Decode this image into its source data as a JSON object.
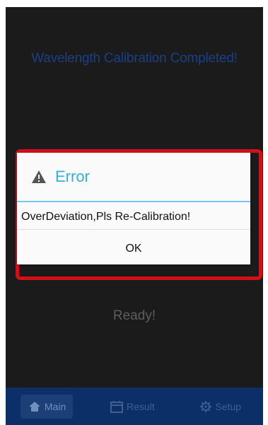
{
  "screen": {
    "status_title": "Wavelength Calibration Completed!",
    "ready_text": "Ready!"
  },
  "dialog": {
    "icon": "warning-icon",
    "title": "Error",
    "message": "OverDeviation,Pls Re-Calibration!",
    "ok_label": "OK"
  },
  "navbar": {
    "items": [
      {
        "label": "Main",
        "icon": "home-icon",
        "active": true
      },
      {
        "label": "Result",
        "icon": "calendar-icon",
        "active": false
      },
      {
        "label": "Setup",
        "icon": "gear-icon",
        "active": false
      }
    ]
  },
  "colors": {
    "screen_bg": "#1b1b1b",
    "title_accent": "#35aee0",
    "highlight_border": "#d40f18",
    "navbar_bg": "#0b2f66"
  }
}
